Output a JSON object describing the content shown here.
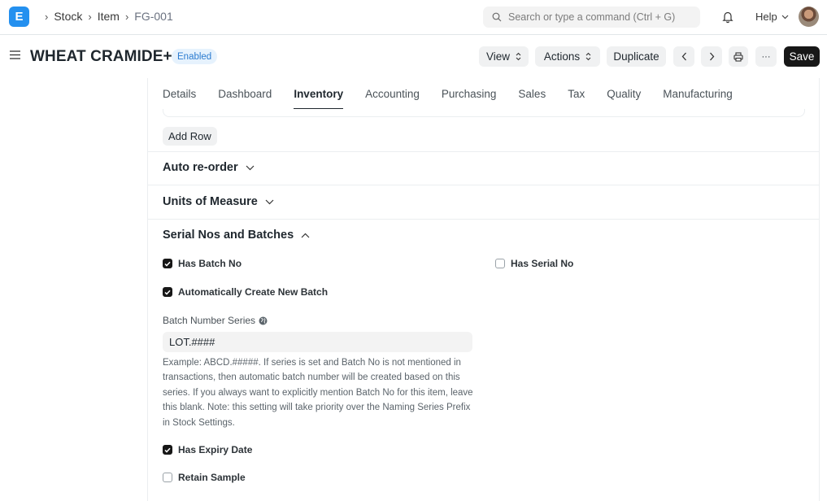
{
  "navbar": {
    "logo_letter": "E",
    "breadcrumbs": [
      "Stock",
      "Item",
      "FG-001"
    ],
    "search_placeholder": "Search or type a command (Ctrl + G)",
    "help_label": "Help"
  },
  "page": {
    "title": "WHEAT CRAMIDE+",
    "status": "Enabled",
    "buttons": {
      "view": "View",
      "actions": "Actions",
      "duplicate": "Duplicate",
      "more": "···",
      "save": "Save"
    }
  },
  "tabs": [
    "Details",
    "Dashboard",
    "Inventory",
    "Accounting",
    "Purchasing",
    "Sales",
    "Tax",
    "Quality",
    "Manufacturing"
  ],
  "active_tab": "Inventory",
  "add_row_label": "Add Row",
  "sections": {
    "auto_reorder": "Auto re-order",
    "uom": "Units of Measure",
    "serial_batches": "Serial Nos and Batches"
  },
  "fields": {
    "has_batch_no": {
      "label": "Has Batch No",
      "checked": true
    },
    "has_serial_no": {
      "label": "Has Serial No",
      "checked": false
    },
    "auto_create_batch": {
      "label": "Automatically Create New Batch",
      "checked": true
    },
    "batch_series_label": "Batch Number Series",
    "batch_series_value": "LOT.####",
    "batch_series_description": "Example: ABCD.#####. If series is set and Batch No is not mentioned in transactions, then automatic batch number will be created based on this series. If you always want to explicitly mention Batch No for this item, leave this blank. Note: this setting will take priority over the Naming Series Prefix in Stock Settings.",
    "has_expiry_date": {
      "label": "Has Expiry Date",
      "checked": true
    },
    "retain_sample": {
      "label": "Retain Sample",
      "checked": false
    }
  },
  "colors": {
    "accent": "#2490ef",
    "primary_button": "#171717",
    "badge_bg": "#e6f2fd",
    "badge_text": "#2b7bd0"
  }
}
